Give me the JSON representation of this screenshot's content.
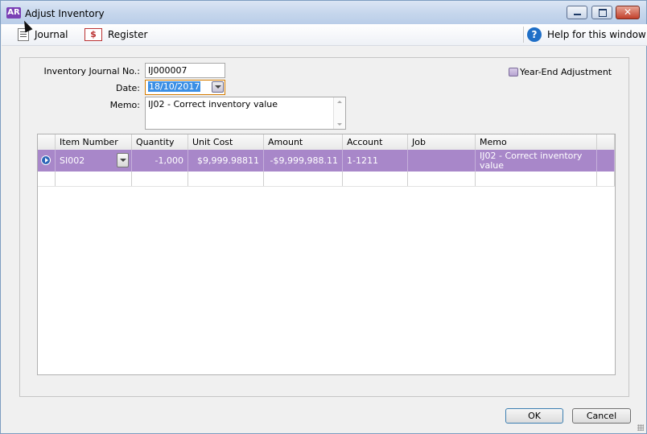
{
  "window": {
    "app_badge": "AR",
    "title": "Adjust Inventory"
  },
  "toolbar": {
    "journal_label": "Journal",
    "register_label": "Register",
    "register_icon_text": "$",
    "help_label": "Help for this window"
  },
  "form": {
    "journal_no_label": "Inventory Journal No.:",
    "journal_no_value": "IJ000007",
    "date_label": "Date:",
    "date_value": "18/10/2017",
    "memo_label": "Memo:",
    "memo_value": "IJ02 - Correct inventory value",
    "year_end_label": "Year-End Adjustment",
    "year_end_checked": false
  },
  "grid": {
    "columns": [
      "",
      "Item Number",
      "Quantity",
      "Unit Cost",
      "Amount",
      "Account",
      "Job",
      "Memo",
      ""
    ],
    "rows": [
      {
        "item_number": "SI002",
        "quantity": "-1,000",
        "unit_cost": "$9,999.98811",
        "amount": "-$9,999,988.11",
        "account": "1-1211",
        "job": "",
        "memo": "IJ02 - Correct inventory value"
      }
    ],
    "selected_row_color": "#a887c9"
  },
  "buttons": {
    "ok": "OK",
    "cancel": "Cancel"
  }
}
